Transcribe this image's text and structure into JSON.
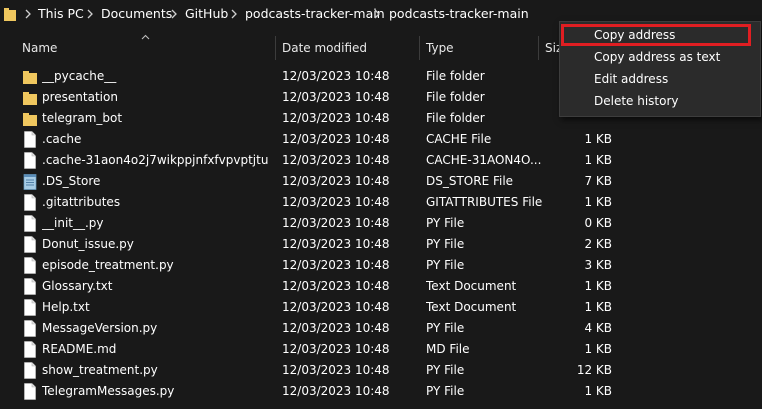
{
  "breadcrumb": [
    {
      "label": "This PC"
    },
    {
      "label": "Documents"
    },
    {
      "label": "GitHub"
    },
    {
      "label": "podcasts-tracker-main"
    },
    {
      "label": "podcasts-tracker-main"
    }
  ],
  "columns": {
    "name": "Name",
    "date": "Date modified",
    "type": "Type",
    "size": "Siz"
  },
  "files": [
    {
      "name": "__pycache__",
      "date": "12/03/2023 10:48",
      "type": "File folder",
      "size": "",
      "icon": "folder-icon"
    },
    {
      "name": "presentation",
      "date": "12/03/2023 10:48",
      "type": "File folder",
      "size": "",
      "icon": "folder-icon"
    },
    {
      "name": "telegram_bot",
      "date": "12/03/2023 10:48",
      "type": "File folder",
      "size": "",
      "icon": "folder-icon"
    },
    {
      "name": ".cache",
      "date": "12/03/2023 10:48",
      "type": "CACHE File",
      "size": "1 KB",
      "icon": "file-icon"
    },
    {
      "name": ".cache-31aon4o2j7wikppjnfxfvpvptjtu",
      "date": "12/03/2023 10:48",
      "type": "CACHE-31AON4O...",
      "size": "1 KB",
      "icon": "file-icon"
    },
    {
      "name": ".DS_Store",
      "date": "12/03/2023 10:48",
      "type": "DS_STORE File",
      "size": "7 KB",
      "icon": "notepad-icon"
    },
    {
      "name": ".gitattributes",
      "date": "12/03/2023 10:48",
      "type": "GITATTRIBUTES File",
      "size": "1 KB",
      "icon": "file-icon"
    },
    {
      "name": "__init__.py",
      "date": "12/03/2023 10:48",
      "type": "PY File",
      "size": "0 KB",
      "icon": "file-icon"
    },
    {
      "name": "Donut_issue.py",
      "date": "12/03/2023 10:48",
      "type": "PY File",
      "size": "2 KB",
      "icon": "file-icon"
    },
    {
      "name": "episode_treatment.py",
      "date": "12/03/2023 10:48",
      "type": "PY File",
      "size": "3 KB",
      "icon": "file-icon"
    },
    {
      "name": "Glossary.txt",
      "date": "12/03/2023 10:48",
      "type": "Text Document",
      "size": "1 KB",
      "icon": "file-icon"
    },
    {
      "name": "Help.txt",
      "date": "12/03/2023 10:48",
      "type": "Text Document",
      "size": "1 KB",
      "icon": "file-icon"
    },
    {
      "name": "MessageVersion.py",
      "date": "12/03/2023 10:48",
      "type": "PY File",
      "size": "4 KB",
      "icon": "file-icon"
    },
    {
      "name": "README.md",
      "date": "12/03/2023 10:48",
      "type": "MD File",
      "size": "1 KB",
      "icon": "file-icon"
    },
    {
      "name": "show_treatment.py",
      "date": "12/03/2023 10:48",
      "type": "PY File",
      "size": "12 KB",
      "icon": "file-icon"
    },
    {
      "name": "TelegramMessages.py",
      "date": "12/03/2023 10:48",
      "type": "PY File",
      "size": "1 KB",
      "icon": "file-icon"
    }
  ],
  "context_menu": {
    "items": [
      {
        "label": "Copy address"
      },
      {
        "label": "Copy address as text"
      },
      {
        "label": "Edit address"
      },
      {
        "label": "Delete history"
      }
    ],
    "highlight_color": "#e01e22"
  },
  "colors": {
    "background": "#191919",
    "folder": "#f0c75e",
    "text": "#ffffff"
  }
}
